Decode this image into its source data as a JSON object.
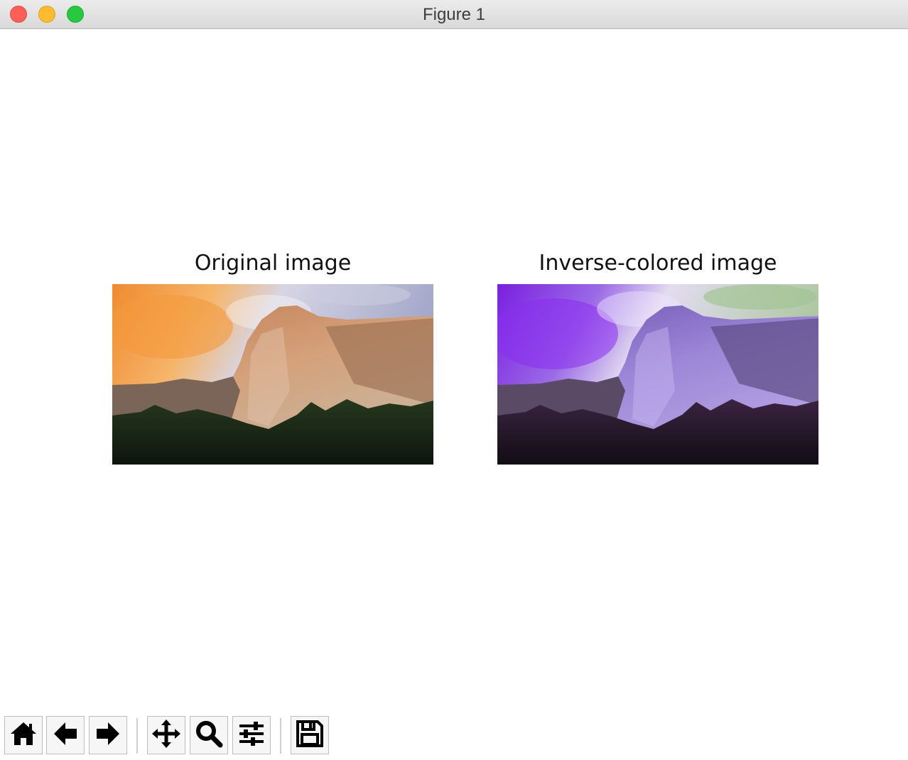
{
  "window": {
    "title": "Figure 1"
  },
  "figure": {
    "subplots": [
      {
        "title": "Original image"
      },
      {
        "title": "Inverse-colored image"
      }
    ]
  },
  "toolbar": {
    "buttons": [
      {
        "icon": "home-icon"
      },
      {
        "icon": "back-arrow-icon"
      },
      {
        "icon": "forward-arrow-icon"
      },
      {
        "icon": "pan-icon"
      },
      {
        "icon": "zoom-magnifier-icon"
      },
      {
        "icon": "configure-subplots-icon"
      },
      {
        "icon": "save-icon"
      }
    ]
  },
  "colors": {
    "close": "#fe5f57",
    "minimize": "#febc2e",
    "zoom": "#28c840"
  }
}
